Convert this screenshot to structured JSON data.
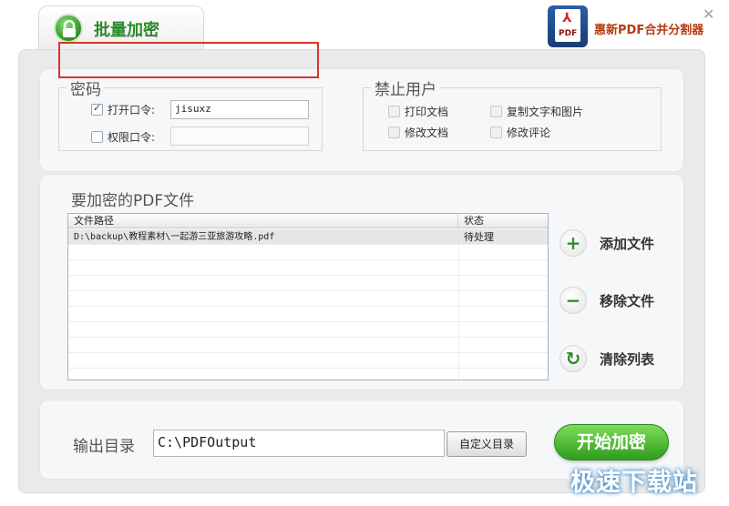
{
  "window": {
    "title": "批量加密",
    "brand": "惠新PDF合并分割器",
    "close_glyph": "✕",
    "pdf_mark": "⅄",
    "pdf_label": "PDF"
  },
  "password": {
    "legend": "密码",
    "open_label": "打开口令:",
    "open_checked": true,
    "open_value": "jisuxz",
    "perm_label": "权限口令:",
    "perm_checked": false,
    "perm_value": ""
  },
  "forbid": {
    "legend": "禁止用户",
    "options": [
      {
        "label": "打印文档",
        "checked": false
      },
      {
        "label": "复制文字和图片",
        "checked": false
      },
      {
        "label": "修改文档",
        "checked": false
      },
      {
        "label": "修改评论",
        "checked": false
      }
    ]
  },
  "files": {
    "title": "要加密的PDF文件",
    "columns": [
      "文件路径",
      "状态"
    ],
    "rows": [
      {
        "path": "D:\\backup\\教程素材\\一起游三亚旅游攻略.pdf",
        "status": "待处理"
      }
    ]
  },
  "actions": {
    "add": {
      "label": "添加文件",
      "glyph": "+"
    },
    "remove": {
      "label": "移除文件",
      "glyph": "−"
    },
    "clear": {
      "label": "清除列表",
      "glyph": "↻"
    }
  },
  "output": {
    "label": "输出目录",
    "path": "C:\\PDFOutput",
    "browse": "自定义目录",
    "start": "开始加密"
  },
  "watermark": "极速下载站",
  "colors": {
    "accent_green": "#2e9d1e",
    "highlight_red": "#d8342c",
    "brand_orange": "#b43b12"
  }
}
